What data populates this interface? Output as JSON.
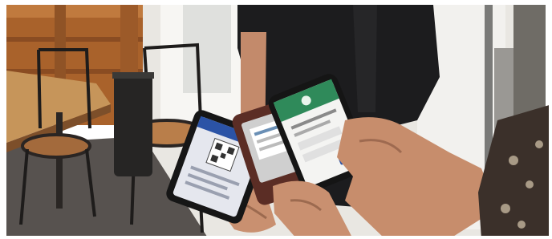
{
  "photo": {
    "description_visible_text": "",
    "palette": {
      "wall_wood": "#b0692f",
      "wall_wood_dark": "#7a4520",
      "table_top": "#c99a5f",
      "floor": "#5a5552",
      "window_light": "#f4f2ee",
      "shirt": "#1d1d1f",
      "skin": "#c98e6e",
      "skin_shadow": "#9e6a50",
      "phone_body": "#161616",
      "phone_case": "#5b2d25",
      "screen_white": "#f2f2f2",
      "screen_green": "#2f8a5a",
      "screen_blue": "#2b53a6",
      "scarf": "#3a2f2a"
    }
  }
}
